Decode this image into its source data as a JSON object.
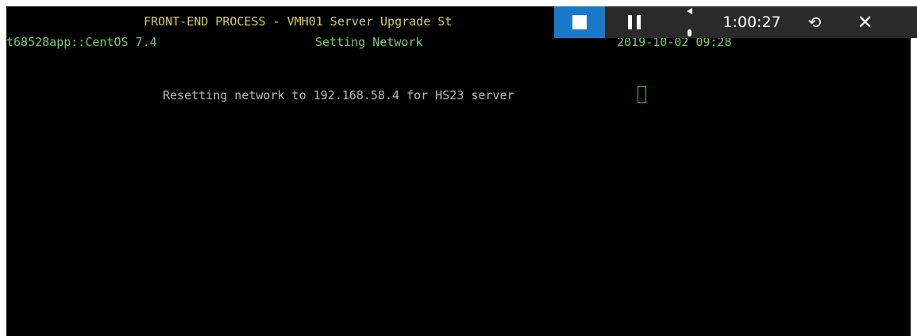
{
  "terminal": {
    "header_title": "FRONT-END PROCESS - VMH01 Server Upgrade St",
    "host_info": "t68528app::CentOS 7.4",
    "stage": "Setting Network",
    "timestamp": "2019-10-02 09:28",
    "message_prefix": "Resetting network to ",
    "message_ip": "192.168.58.4",
    "message_suffix": " for HS23 server "
  },
  "recorder": {
    "elapsed": "1:00:27",
    "stop_icon": "stop-icon",
    "pause_icon": "pause-icon",
    "speaker_icon": "speaker-icon",
    "mic_icon": "microphone-icon",
    "restart_glyph": "⟲",
    "close_glyph": "✕",
    "accent": "#1979c9"
  },
  "colors": {
    "header": "#d6c95c",
    "status": "#7cc96b",
    "message": "#b8b8b8",
    "cursor": "#3ecf4a",
    "background": "#000000"
  }
}
